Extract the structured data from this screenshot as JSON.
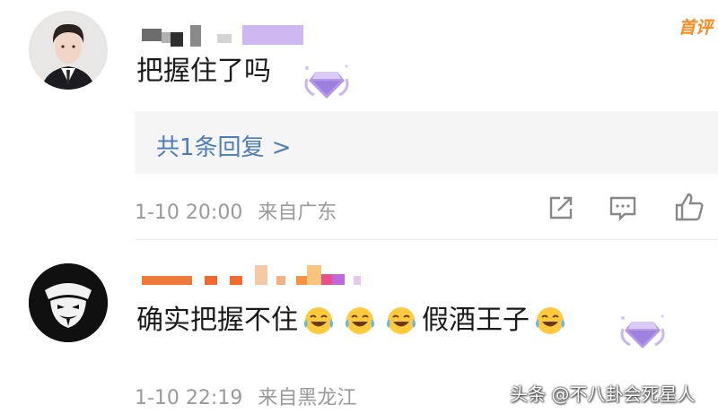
{
  "comment1": {
    "text": "把握住了吗",
    "badge": "hot-comment-label",
    "badge_label": "首评",
    "reply_link": "共1条回复 >",
    "time": "1-10 20:00",
    "location": "来自广东"
  },
  "comment2": {
    "text_part1": "确实把握不住",
    "text_part2": "假酒王子",
    "emoji": "laughing-crying-emoji",
    "time": "1-10 22:19",
    "location": "来自黑龙江"
  },
  "watermark": "头条 @不八卦会死星人",
  "colors": {
    "link": "#4f7db8",
    "meta": "#9a9a9a",
    "hot": "#ff8a1e",
    "reply_bg": "#f5f5f5"
  }
}
